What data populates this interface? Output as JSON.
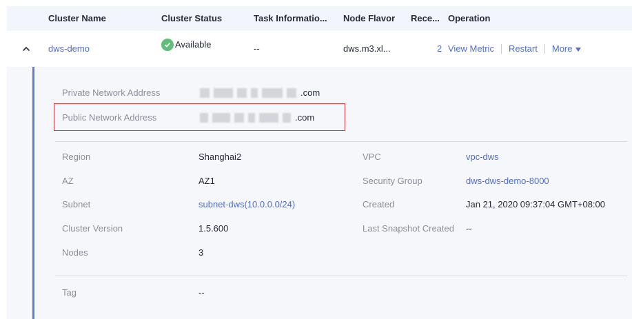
{
  "table": {
    "headers": {
      "name": "Cluster Name",
      "status": "Cluster Status",
      "task": "Task Informatio...",
      "flavor": "Node Flavor",
      "recent": "Rece...",
      "operation": "Operation"
    },
    "row": {
      "name": "dws-demo",
      "status": "Available",
      "task": "--",
      "flavor": "dws.m3.xl...",
      "recent": "2",
      "view_metric": "View Metric",
      "restart": "Restart",
      "more": "More"
    }
  },
  "detail": {
    "private_label": "Private Network Address",
    "private_suffix": ".com",
    "public_label": "Public Network Address",
    "public_suffix": ".com",
    "region_label": "Region",
    "region_value": "Shanghai2",
    "az_label": "AZ",
    "az_value": "AZ1",
    "subnet_label": "Subnet",
    "subnet_value": "subnet-dws(10.0.0.0/24)",
    "version_label": "Cluster Version",
    "version_value": "1.5.600",
    "nodes_label": "Nodes",
    "nodes_value": "3",
    "vpc_label": "VPC",
    "vpc_value": "vpc-dws",
    "sg_label": "Security Group",
    "sg_value": "dws-dws-demo-8000",
    "created_label": "Created",
    "created_value": "Jan 21, 2020 09:37:04 GMT+08:00",
    "snapshot_label": "Last Snapshot Created",
    "snapshot_value": "--",
    "tag_label": "Tag",
    "tag_value": "--"
  },
  "colors": {
    "link": "#526ecc",
    "status_ok": "#5fbf7a",
    "highlight_border": "#d9363e"
  }
}
